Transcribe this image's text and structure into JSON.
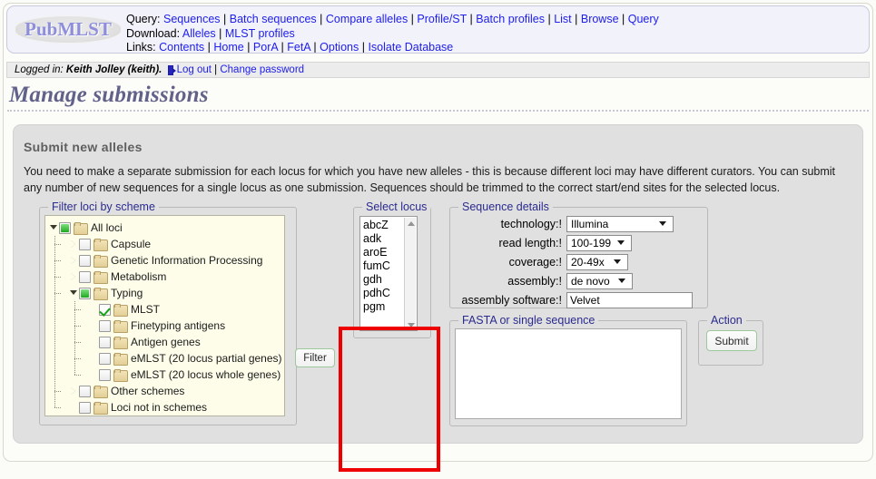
{
  "header": {
    "logo_text": "PubMLST",
    "rows": [
      {
        "label": "Query:",
        "links": [
          "Sequences",
          "Batch sequences",
          "Compare alleles",
          "Profile/ST",
          "Batch profiles",
          "List",
          "Browse",
          "Query"
        ]
      },
      {
        "label": "Download:",
        "links": [
          "Alleles",
          "MLST profiles"
        ]
      },
      {
        "label": "Links:",
        "links": [
          "Contents",
          "Home",
          "PorA",
          "FetA",
          "Options",
          "Isolate Database"
        ]
      }
    ]
  },
  "loginbar": {
    "prefix": "Logged in:",
    "user": "Keith Jolley (keith).",
    "logout_label": "Log out",
    "separator": "|",
    "change_password_label": "Change password"
  },
  "page_title": "Manage submissions",
  "content": {
    "section_title": "Submit new alleles",
    "intro": "You need to make a separate submission for each locus for which you have new alleles - this is because different loci may have different curators. You can submit any number of new sequences for a single locus as one submission. Sequences should be trimmed to the correct start/end sites for the selected locus."
  },
  "filter_panel": {
    "legend": "Filter loci by scheme",
    "filter_button": "Filter",
    "tree": [
      {
        "label": "All loci",
        "depth": 0,
        "state": "partial",
        "expander": "open"
      },
      {
        "label": "Capsule",
        "depth": 1,
        "state": "unchecked",
        "expander": "closed"
      },
      {
        "label": "Genetic Information Processing",
        "depth": 1,
        "state": "unchecked",
        "expander": "closed"
      },
      {
        "label": "Metabolism",
        "depth": 1,
        "state": "unchecked",
        "expander": "closed"
      },
      {
        "label": "Typing",
        "depth": 1,
        "state": "partial",
        "expander": "open"
      },
      {
        "label": "MLST",
        "depth": 2,
        "state": "checked",
        "expander": "none"
      },
      {
        "label": "Finetyping antigens",
        "depth": 2,
        "state": "unchecked",
        "expander": "none"
      },
      {
        "label": "Antigen genes",
        "depth": 2,
        "state": "unchecked",
        "expander": "none"
      },
      {
        "label": "eMLST (20 locus partial genes)",
        "depth": 2,
        "state": "unchecked",
        "expander": "none"
      },
      {
        "label": "eMLST (20 locus whole genes)",
        "depth": 2,
        "state": "unchecked",
        "expander": "none"
      },
      {
        "label": "Other schemes",
        "depth": 1,
        "state": "unchecked",
        "expander": "closed"
      },
      {
        "label": "Loci not in schemes",
        "depth": 1,
        "state": "unchecked",
        "expander": "none"
      }
    ]
  },
  "locus_panel": {
    "legend": "Select locus",
    "items": [
      "abcZ",
      "adk",
      "aroE",
      "fumC",
      "gdh",
      "pdhC",
      "pgm"
    ],
    "highlight_color": "#ee0000"
  },
  "sequence_details": {
    "legend": "Sequence details",
    "rows": [
      {
        "label": "technology:!",
        "value": "Illumina",
        "type": "select",
        "width": 118
      },
      {
        "label": "read length:!",
        "value": "100-199",
        "type": "select",
        "width": 72
      },
      {
        "label": "coverage:!",
        "value": "20-49x",
        "type": "select",
        "width": 68
      },
      {
        "label": "assembly:!",
        "value": "de novo",
        "type": "select",
        "width": 73
      },
      {
        "label": "assembly software:!",
        "value": "Velvet",
        "type": "text",
        "width": 139
      }
    ]
  },
  "fasta_panel": {
    "legend": "FASTA or single sequence",
    "value": ""
  },
  "action_panel": {
    "legend": "Action",
    "submit_label": "Submit"
  }
}
